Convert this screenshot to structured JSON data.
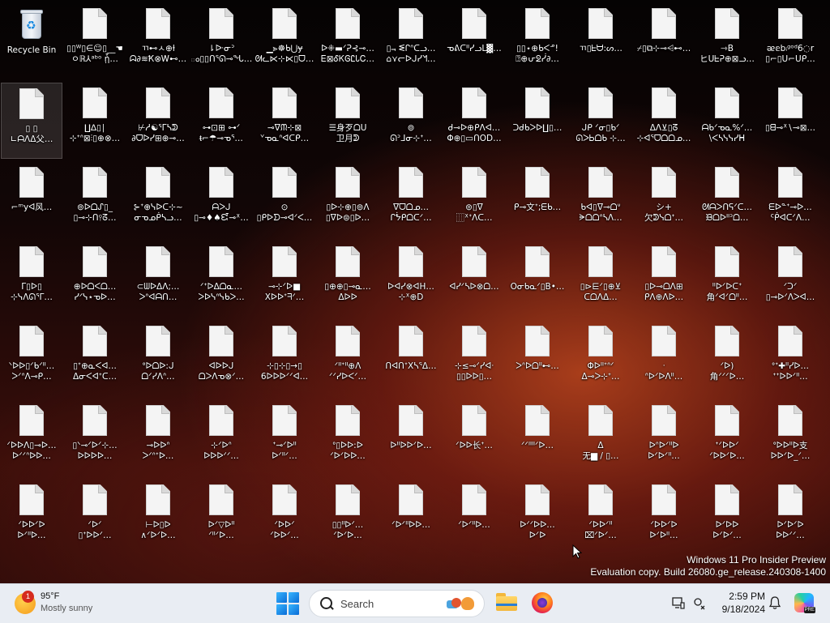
{
  "desktop": {
    "recycle_bin": {
      "label": "Recycle Bin",
      "icon": "recycle-bin-icon"
    },
    "file_icon": "blank-document-icon",
    "selected_index": 12,
    "files": [
      "▯▯ᵂ▯∈☺▯__☚\nㅇℝ⅄ᵃᵇᵒ ᾗ…",
      "ㄲ⊷ㅅ⊕ƚ\nᗣ∂≋Ҟ⊗Ꮃ⊷…",
      "⇂ᐕᓂᐣ\nం▯▯ᑎᕐᘏ⊸ᖓ…",
      "▁⪢☸ᑲ⋃ɏ\nᘛᓚ⋉⊹⋉▯ᗜ…",
      "ᐅ⁜▬ᐟᕈ⊰⊸…\nᎬ⊠ᎴᏦᎶᏝᏓᏟ…",
      "▯⫬ ᓬᒋᐢᑕᓗ…\n⌂⋎ᓕᐅᒍᓯᖿ…",
      "ᓀᕕᑕᐦᓯᓗᒪ▓…",
      "▯▯⋆⊕ᑲᐸᓒ!\n⍰⊕ᕂᘖᓰ∂…",
      "ㄲ▯ᖶᗨ:ᔕ…",
      "⌿▯⧉⊹⊸⩤⊷…",
      "⇾B\nヒᑌᖶᕈ⊕⊠ᓗ…",
      "ᴂ𝕖bᵢᵍᵒᵈ6◌r\n▯⌐▯ᑌ⌐ᑌᑭ…",
      "▯ ▯\n∟ᗩᐱᐃ父…",
      "∐∆▯∣\n⊹ᐩᐢ⊠⫶▯⊕⊗…",
      "⊬ᓱ☯ᕐᒥᓴᕲ\n∂ᗜᐅᓯ⊞⊕⊸…",
      "⊶⊡⊞ ⊶ᐟ\nᵵ⌐☂⊸ᓀᕐ…",
      "⊸ᐁᙏ⊹⊠\nᘁᓀᓇᐢᐊᑕᑭ…",
      "☰身歹ᗝᑌ\n卫月ᕲ",
      "⊚\nᘏᐣᒧᓂ⊹ᐩ…",
      "ᑯ⊸ᐅ⊕ᑭᐱᐊ…\nΦ⊕▯▭ᑎOD…",
      "ᑒᑰᑲᐳᐅ∐▯…",
      "ᒍᑭ ᐟᓂ▯ᑲᐟ\nᘏᐳᏏᗝᑲ ⊹…",
      "ᐃᐱ⊻▯ᘔ\n⊹ᐊᕐᗜᗝᗝᓄ…",
      "ᗩᑲᐟᓀᓇ%ᐟ…\n\\ᐸᓴᓭᓭᓯᕼ",
      "▯ᗺ⊸ᕁ∖⊸⊠…",
      "⌐ᵐyᐊ风…",
      "⊚ᐅᗝᔑ▯_\n▯⊸⊹ᑎ⫯ᘔ…",
      "⊱ᐩ⊕ᓭᐅᑖ⊹~\nᓂᓀᓄᑮᓴᓗ…",
      "ᗩᐳᒍ\n▯⊸♦♠ᘿ⊸ᕁ…",
      "⊙\n▯ᑭᐅᗤ⊸ᐊᐟᐸ…",
      "▯ᐅ⊹⊕▯⊚ᐱ\n▯ᐁᐅ⊜▯ᐅ…",
      "ᐁᗜᗝᓄ…\nᒋᖭᑭᗝᑕᐟ…",
      "⊚▯ᐁ\n⿲ᕽᐩᐱᑕ…",
      "ᑭ⊸文ᐩ;ᗴᑲ…",
      "ᑲᐊ▯ᐁ⊸ᗝᐡ\nᗓᗝᗝᐢᓴᐱ…",
      "シ+\n欠ᕲᓭᗝᐩ…",
      "ᘛᗩᐳᑎᕋᐟᑕ…\nᙖᗝᐅᐦᐣᗝ…",
      "ᗴᐅᓐᐩ⊸ᐅ…\nᑦᑮᐊᑕᐟᐱ…",
      "ᒥ▯ᐅ▯\n⊹ᓭᐱᘏᕐᒥ…",
      "⊕ᐅᗝᐸᗝ…\nᓯᐟᓭ⋆ᓀᐅ…",
      "⊂ᗯᐅᐃᐱ;…\nᐳᐢᐊᗩᑎ…",
      "ᐟᐩᐅᐃᗝᓇ…\nᐳᐅᓭᐢᓭᑲᐳ…",
      "⊸⊹ᐟᐅ■\nXᐅᐅᐩᖷᐟ…",
      "▯⊕⊕▯⊸ᓇ…\nᐃᐅᐅ",
      "ᐅᐊᓯ⊗ᐊH…\n⊹ᕽ⊕D",
      "ᐊᓯᐟᓴᐅ⊗ᗝ…",
      "Oᓂᑲᓇᐟ▯B•…",
      "▯⊳⋿ᐟ▯⊕⊻\nᑕᗝᐱᐃ…",
      "▯ᐅ⊸ᗝᐱ⊞\nᑭᐱ⊕ᐱᐅ…",
      "ᐦᐅᐟᐅᑕᐩ\n角ᐟᐊᐟᗝᐦ…",
      "ᐟᑐᐟ\n▯⊸ᐅᐟᐱᐳᐊ…",
      "ᐠᐅᐅ▯ᐟᑲᐟᐦ…\nᐳᐟᐢᐱ⊸ᑭ…",
      "▯ᐩ⊕ᓇᐸᐊ…\nᐃᓂᐸᐊᐩᑕ…",
      "ᐤᐅᗝᐅ:ᒍ\nᗝᐟᓯᐱᐢ…",
      "ᐊᐅᐅᒍ\nᗝᐳᐱᓀ⊗ᐟ…",
      "⊹▯⊹▯→▯\n6ᐅᐅᐅᐟᐟᐊ…",
      "ᐟᐦᐩᐦ⊕ᐱ\nᐟᐟᓯᐅᐸᐟ…",
      "ᑎᐊᑎᐩXᓴᕐᐃ…",
      "⊹≤⊸ᐟᓯᐊᐧ\n▯▯ᐅᐅ▯…",
      "ᐳᐢᐅᗝᐦ⊷…",
      "Φᐅᐦᐩᐢᐟ\nᐃ⊸ᐳ⊹ᐩ…",
      "ᐧ\nᐢᐅᐟᐅᐱᐦ…",
      "ᐟᐅ)\n角ᐟᐟᐟᐅ…",
      "ᐤᐩ✚ᐦᓯᐅ…\nᐩᐩᐅᐅᐟᐦ…",
      "ᐟᐅᐅᐱ▯⊸ᐅ…\nᐅᐟᐟᐢᐅᐅ…",
      "▯ᐠ⊸ᐟᐅᐟ⊹…\nᐅᐅᐅᐅ…",
      "⊸ᐅᐅᐢ\nᐳᐟᐢᐩᐅ…",
      "⊹ᐟᐅᐢ\nᐅᐅᐅᐟᐟ…",
      "ᐩ⊸ᐟᐅᐦ\nᐅᐟᐦᐟ…",
      "ᐤ▯ᐅᐅ:ᐅ\nᐟᐅᐟᐅᐅ…",
      "ᐅᐦᐅᐅᐟᐅ…",
      "ᐟᐅᐅ长ᐩ…",
      "ᐟᐟᐦᐦᐟᐅ…",
      "ᐃ\n无▆ / ▯…",
      "ᐅᐢᐅᐟᐦᐅ\nᐅᐟᐅᐟᐦ…",
      "ᐩᐟᐅᐅᐟ\nᐟᐅᐅᐟᐅ…",
      "ᐤᐅᐅᐦᐅ支\nᐅᐅᐟᐅ_ᐟ…",
      "ᐟᐅᐅᐟᐅ\nᐅᐟᐦᐅ…",
      "ᐟᐅᐟ\n▯ᐩᐅᐅᐟ…",
      "⊢ᐅ▯ᐅ\n∧ᐟᐅᐟᐅ…",
      "ᐅᐟ▽ᐅᐦ\nᐟᐦᐟᐅ…",
      "ᐟᐅᐅᐟ\nᐟᐅᐅᐟ…",
      "▯▯ᐦᐅᐟ…\nᐟᐅᐟᐅ…",
      "ᐟᐅᐟᐦᐅᐅ…",
      "ᐟᐅᐟᐦᐅ…",
      "ᐅᐟᐟᐅᐅ…\nᐅᐟᐅ",
      "ᐟᐅᐅᐟᐦ\n⌧ᐟᐅᐟ…",
      "ᐟᐅᐅᐟᐅ\nᐅᐟᐅᐦ…",
      "ᐅᐟᐅᐅ\nᐅᐟᐅᐟ…",
      "ᐅᐟᐅᐟᐅ\nᐅᐅᐟᐟ…"
    ]
  },
  "watermark": {
    "line1": "Windows 11 Pro Insider Preview",
    "line2": "Evaluation copy. Build 26080.ge_release.240308-1400"
  },
  "taskbar": {
    "weather": {
      "temp": "95°F",
      "condition": "Mostly sunny",
      "badge": "1",
      "icon": "sun-icon"
    },
    "start_icon": "windows-start-icon",
    "search": {
      "label": "Search",
      "icon": "search-icon"
    },
    "pinned": [
      "file-explorer-icon",
      "firefox-icon"
    ],
    "tray": [
      "display-icon",
      "settings-sync-icon"
    ],
    "clock": {
      "time": "2:59 PM",
      "date": "9/18/2024"
    },
    "notification_icon": "bell-icon",
    "copilot": {
      "icon": "copilot-icon",
      "tag": "PRE"
    }
  }
}
